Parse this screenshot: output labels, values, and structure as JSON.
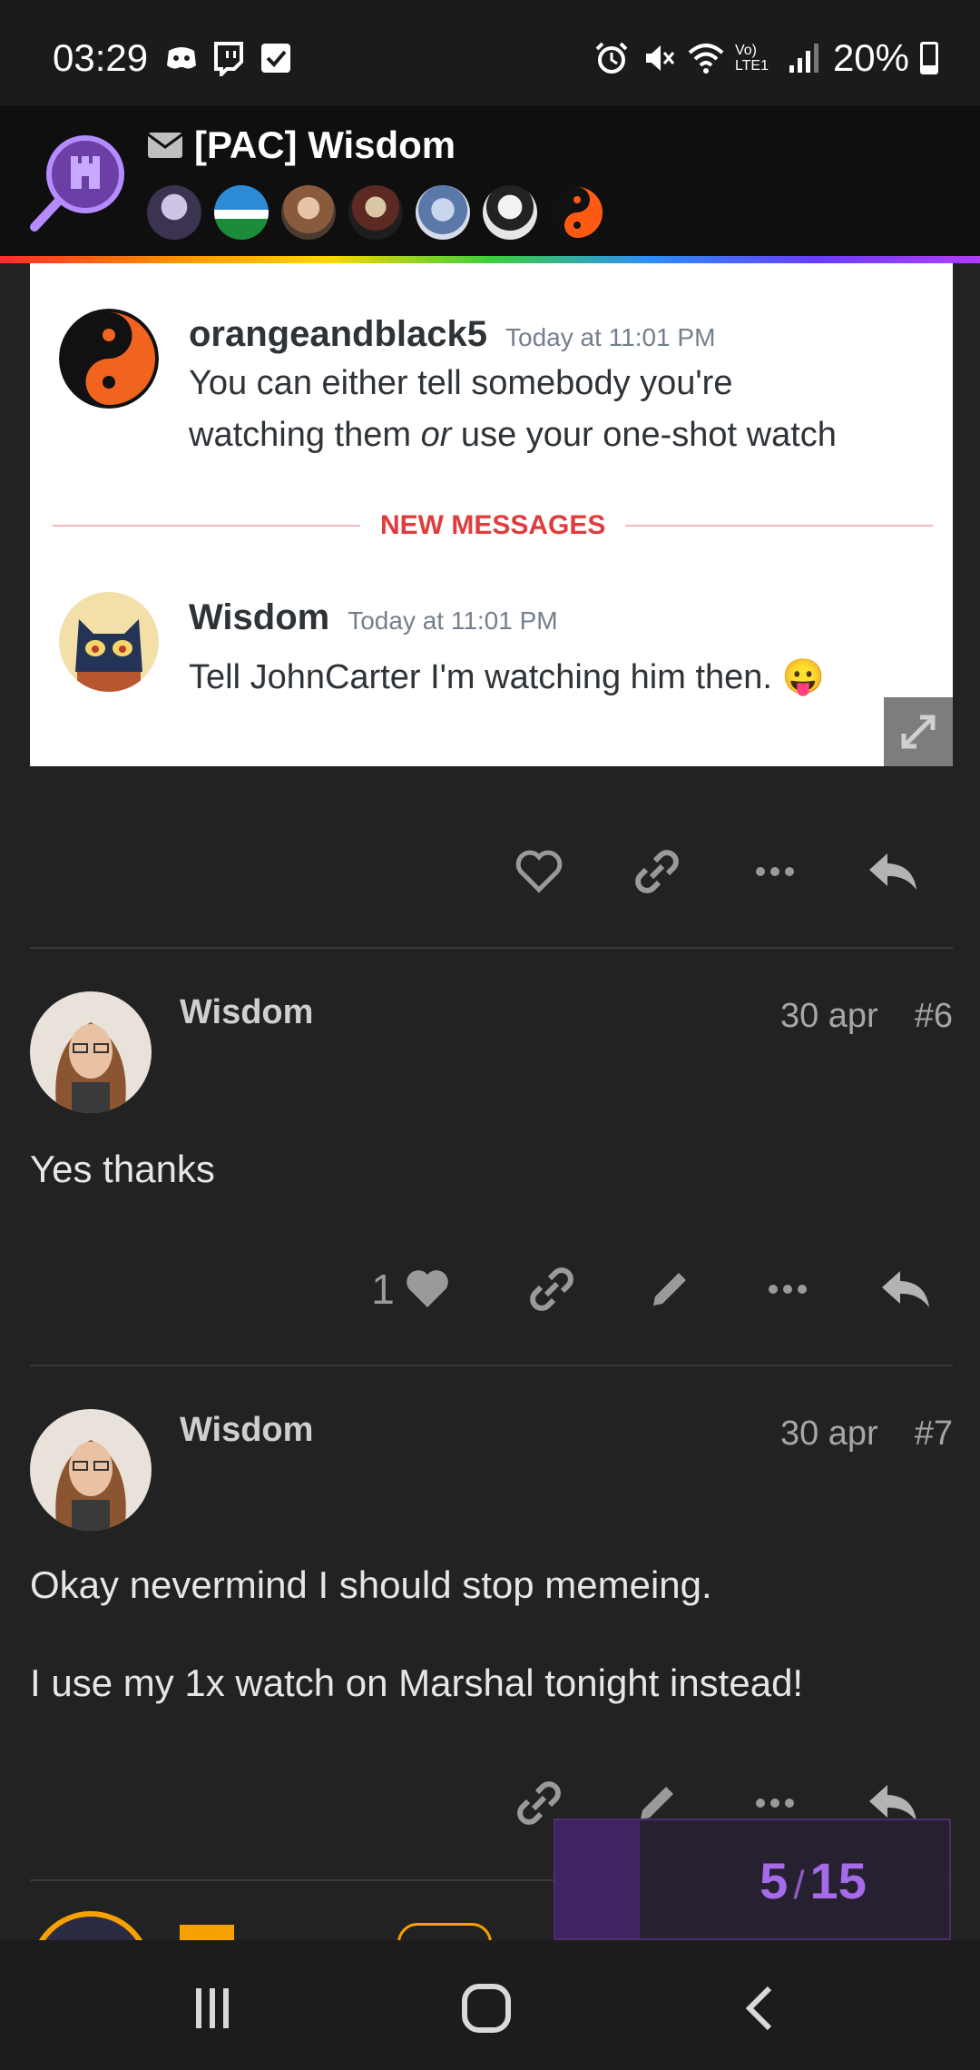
{
  "status_bar": {
    "time": "03:29",
    "left_icons": [
      "discord-icon",
      "twitch-icon",
      "checkbox-icon"
    ],
    "right_icons": [
      "alarm-icon",
      "mute-icon",
      "wifi-icon",
      "volte-icon",
      "signal-icon"
    ],
    "volte_label": "Vo) LTE1",
    "battery_text": "20%",
    "battery_level": 0.2
  },
  "header": {
    "title": "[PAC] Wisdom",
    "participant_avatars": [
      "avatar-1",
      "avatar-2",
      "avatar-3",
      "avatar-4",
      "avatar-5",
      "avatar-6",
      "avatar-7"
    ]
  },
  "embedded_screenshot": {
    "message1": {
      "author": "orangeandblack5",
      "time": "Today at 11:01 PM",
      "text_line1": "You can either tell somebody you're",
      "text_line2_pre": "watching them ",
      "text_line2_em": "or",
      "text_line2_post": " use your one-shot watch"
    },
    "divider_label": "NEW MESSAGES",
    "message2": {
      "author": "Wisdom",
      "time": "Today at 11:01 PM",
      "text": "Tell JohnCarter I'm watching him then.",
      "emoji": "😛"
    }
  },
  "posts": [
    {
      "author": "Wisdom",
      "date": "30 apr",
      "number": "#6",
      "paragraphs": [
        "Yes thanks"
      ],
      "like_count": "1"
    },
    {
      "author": "Wisdom",
      "date": "30 apr",
      "number": "#7",
      "paragraphs": [
        "Okay nevermind I should stop memeing.",
        "I use my 1x watch on Marshal tonight instead!"
      ]
    }
  ],
  "progress": {
    "current": "5",
    "total": "15",
    "slash": "/",
    "fraction": 0.2133
  },
  "colors": {
    "accent": "#a56be8",
    "background": "#222222",
    "divider_red": "#e03c3c"
  }
}
